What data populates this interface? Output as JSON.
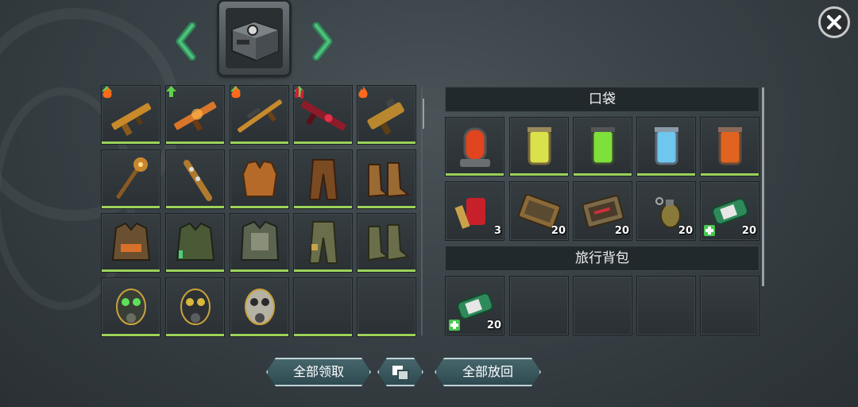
{
  "header": {
    "prev_icon": "chevron-left-icon",
    "next_icon": "chevron-right-icon",
    "chest_icon": "supply-crate-icon",
    "close_icon": "close-icon"
  },
  "colors": {
    "accent_green": "#9bd25a",
    "upgrade_green": "#5fd34a",
    "fire_orange": "#ff6a1a",
    "blood_red": "#d0203a"
  },
  "loot_grid": [
    [
      {
        "icon": "assault-rifle-gold-icon",
        "upgrade": true,
        "mod": "fire"
      },
      {
        "icon": "ak-rifle-fire-icon",
        "upgrade": true,
        "mod": ""
      },
      {
        "icon": "sniper-rifle-gold-icon",
        "upgrade": true,
        "mod": "fire"
      },
      {
        "icon": "blood-rifle-icon",
        "upgrade": true,
        "mod": "blood"
      },
      {
        "icon": "heavy-smg-gold-icon",
        "upgrade": false,
        "mod": "fire"
      }
    ],
    [
      {
        "icon": "spiked-mace-icon",
        "upgrade": false,
        "mod": ""
      },
      {
        "icon": "spiked-club-icon",
        "upgrade": false,
        "mod": ""
      },
      {
        "icon": "leather-vest-icon",
        "upgrade": false,
        "mod": ""
      },
      {
        "icon": "leather-pants-icon",
        "upgrade": false,
        "mod": ""
      },
      {
        "icon": "leather-boots-icon",
        "upgrade": false,
        "mod": ""
      }
    ],
    [
      {
        "icon": "tactical-jacket-orange-icon",
        "upgrade": false,
        "mod": ""
      },
      {
        "icon": "tactical-jacket-green-icon",
        "upgrade": false,
        "mod": ""
      },
      {
        "icon": "armored-jacket-icon",
        "upgrade": false,
        "mod": ""
      },
      {
        "icon": "military-pants-icon",
        "upgrade": false,
        "mod": ""
      },
      {
        "icon": "military-boots-icon",
        "upgrade": false,
        "mod": ""
      }
    ],
    [
      {
        "icon": "gas-mask-green-icon",
        "upgrade": false,
        "mod": ""
      },
      {
        "icon": "gas-mask-hazard-icon",
        "upgrade": false,
        "mod": ""
      },
      {
        "icon": "gas-mask-skull-icon",
        "upgrade": false,
        "mod": ""
      },
      {
        "icon": "",
        "upgrade": false,
        "mod": ""
      },
      {
        "icon": "",
        "upgrade": false,
        "mod": ""
      }
    ]
  ],
  "pocket": {
    "title": "口袋",
    "row1": [
      {
        "icon": "red-canister-icon",
        "color": "#e0451f",
        "qty": ""
      },
      {
        "icon": "yellow-canister-icon",
        "color": "#d9e24a",
        "qty": ""
      },
      {
        "icon": "green-canister-icon",
        "color": "#7ee03a",
        "qty": ""
      },
      {
        "icon": "blue-canister-icon",
        "color": "#6fc6ee",
        "qty": ""
      },
      {
        "icon": "orange-canister-icon",
        "color": "#e0641f",
        "qty": ""
      }
    ],
    "row2": [
      {
        "icon": "red-paint-bucket-icon",
        "qty": "3",
        "med": false
      },
      {
        "icon": "tool-kit-icon",
        "qty": "20",
        "med": false
      },
      {
        "icon": "tool-kit-red-icon",
        "qty": "20",
        "med": false
      },
      {
        "icon": "grenade-icon",
        "qty": "20",
        "med": false
      },
      {
        "icon": "bandage-kit-icon",
        "qty": "20",
        "med": true
      }
    ]
  },
  "backpack": {
    "title": "旅行背包",
    "slots": [
      {
        "icon": "bandage-kit-icon",
        "qty": "20",
        "med": true
      },
      {
        "icon": "",
        "qty": "",
        "med": false
      },
      {
        "icon": "",
        "qty": "",
        "med": false
      },
      {
        "icon": "",
        "qty": "",
        "med": false
      },
      {
        "icon": "",
        "qty": "",
        "med": false
      }
    ]
  },
  "buttons": {
    "take_all": "全部领取",
    "stack_icon": "stack-icon",
    "return_all": "全部放回"
  }
}
